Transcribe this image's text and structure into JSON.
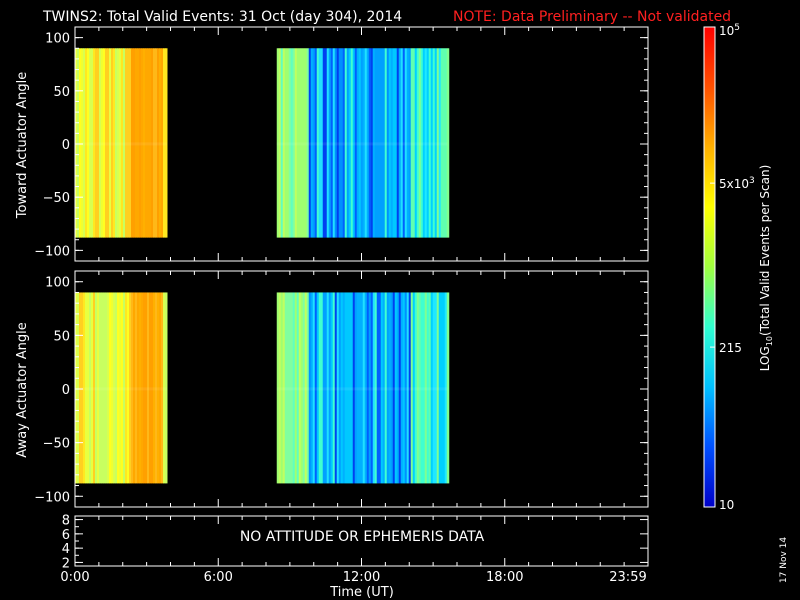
{
  "header": {
    "title": "TWINS2: Total Valid Events: 31 Oct (day 304), 2014",
    "note": "NOTE: Data Preliminary -- Not validated",
    "note_color": "#ff2020"
  },
  "footer": {
    "date_stamp": "17 Nov 14"
  },
  "chart_data": [
    {
      "type": "heatmap",
      "name": "toward-panel",
      "ylabel": "Toward Actuator Angle",
      "ylim": [
        -110,
        110
      ],
      "yticks": [
        "100",
        "50",
        "0",
        "−50",
        "−100"
      ],
      "ytick_values": [
        100,
        50,
        0,
        -50,
        -100
      ],
      "xlim": [
        0,
        24
      ],
      "angle_range": [
        -88,
        90
      ],
      "data_blocks": [
        {
          "start_hour": 0.0,
          "end_hour": 3.85,
          "level": "high"
        },
        {
          "start_hour": 8.45,
          "end_hour": 15.6,
          "level": "mixed"
        }
      ]
    },
    {
      "type": "heatmap",
      "name": "away-panel",
      "ylabel": "Away Actuator Angle",
      "ylim": [
        -110,
        110
      ],
      "yticks": [
        "100",
        "50",
        "0",
        "−50",
        "−100"
      ],
      "ytick_values": [
        100,
        50,
        0,
        -50,
        -100
      ],
      "xlim": [
        0,
        24
      ],
      "angle_range": [
        -88,
        90
      ],
      "data_blocks": [
        {
          "start_hour": 0.0,
          "end_hour": 3.85,
          "level": "high"
        },
        {
          "start_hour": 8.45,
          "end_hour": 15.6,
          "level": "mixed"
        }
      ]
    },
    {
      "type": "line",
      "name": "ephemeris-panel",
      "yticks": [
        "8",
        "6",
        "4",
        "2"
      ],
      "ytick_values": [
        8,
        6,
        4,
        2
      ],
      "ylim": [
        1.5,
        8.5
      ],
      "message": "NO ATTITUDE OR EPHEMERIS DATA"
    }
  ],
  "xaxis": {
    "label": "Time (UT)",
    "ticks": [
      "0:00",
      "6:00",
      "12:00",
      "18:00",
      "23:59"
    ],
    "tick_hours": [
      0,
      6,
      12,
      18,
      23.983
    ]
  },
  "colorbar": {
    "label": "LOG10(Total Valid Events per Scan)",
    "label_main": "LOG",
    "label_sub": "10",
    "label_rest": "(Total Valid Events per Scan)",
    "scale": "log",
    "range": [
      10,
      100000
    ],
    "tick_labels": [
      {
        "value": 100000,
        "base": "10",
        "sup": "5"
      },
      {
        "value": 5000,
        "base": "5x10",
        "sup": "3"
      },
      {
        "value": 215,
        "base": "215",
        "sup": ""
      },
      {
        "value": 10,
        "base": "10",
        "sup": ""
      }
    ],
    "colors": [
      "#0000c8",
      "#0050ff",
      "#00c0ff",
      "#30ffd0",
      "#a0ff40",
      "#ffff00",
      "#ffb000",
      "#ff5000",
      "#ff0000"
    ]
  }
}
